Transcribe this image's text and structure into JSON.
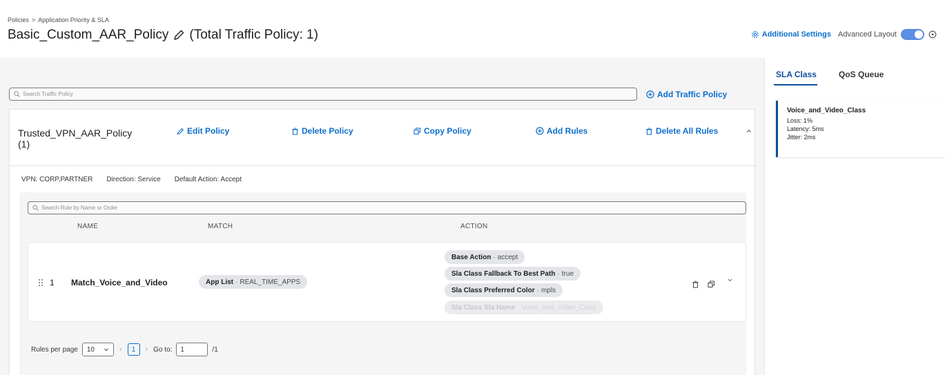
{
  "breadcrumb": {
    "root": "Policies",
    "separator": ">",
    "current": "Application Priority & SLA"
  },
  "page": {
    "title": "Basic_Custom_AAR_Policy",
    "suffix": "(Total Traffic Policy: 1)"
  },
  "header": {
    "additional_settings": "Additional Settings",
    "advanced_layout": "Advanced Layout"
  },
  "traffic_search": {
    "placeholder": "Search Traffic Policy"
  },
  "add_traffic_policy": "Add Traffic Policy",
  "policy": {
    "name": "Trusted_VPN_AAR_Policy",
    "count": "(1)",
    "actions": {
      "edit": "Edit Policy",
      "delete": "Delete Policy",
      "copy": "Copy Policy",
      "add_rules": "Add Rules",
      "delete_all": "Delete All Rules"
    },
    "vpn": "VPN: CORP,PARTNER",
    "direction": "Direction: Service",
    "default_action": "Default Action: Accept"
  },
  "rule_search": {
    "placeholder": "Search Rule by Name or Order"
  },
  "columns": {
    "name": "NAME",
    "match": "MATCH",
    "action": "ACTION"
  },
  "rule": {
    "order": "1",
    "name": "Match_Voice_and_Video",
    "match": {
      "key": "App List",
      "value": "REAL_TIME_APPS"
    },
    "actions": [
      {
        "key": "Base Action",
        "value": "accept"
      },
      {
        "key": "Sla Class Fallback To Best Path",
        "value": "true"
      },
      {
        "key": "Sla Class Preferred Color",
        "value": "mpls"
      },
      {
        "key": "Sla Class Sla Name",
        "value": "Voice_and_Video_Class"
      }
    ],
    "chip_sep": "·"
  },
  "pager": {
    "rows_label": "Rules per page",
    "rows_value": "10",
    "current_page": "1",
    "goto_label": "Go to:",
    "goto_value": "1",
    "total": "/1"
  },
  "right_panel": {
    "tabs": [
      "SLA Class",
      "QoS Queue"
    ],
    "sla": {
      "name": "Voice_and_Video_Class",
      "loss": "Loss: 1%",
      "latency": "Latency: 5ms",
      "jitter": "Jitter: 2ms"
    }
  },
  "colors": {
    "accent": "#0d6ecd",
    "toggle": "#5a8fe3",
    "panel_bg": "#f5f5f6"
  }
}
